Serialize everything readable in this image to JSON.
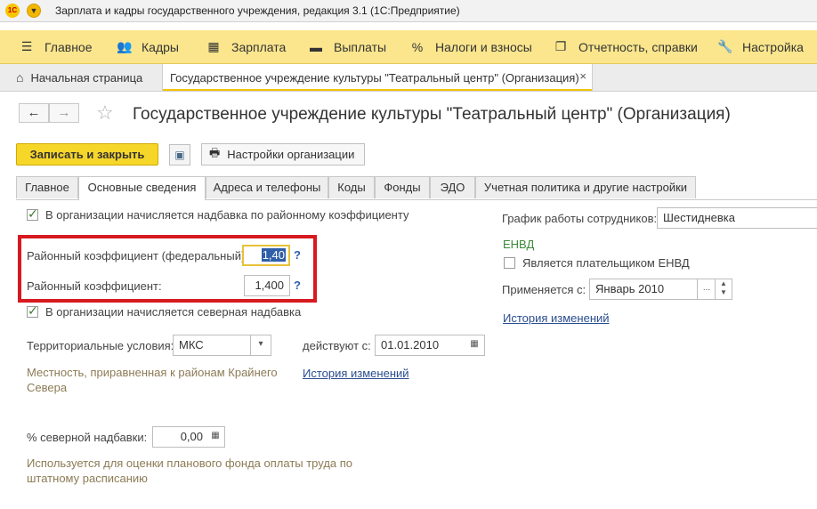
{
  "titlebar": {
    "logo_text": "1С",
    "menu_glyph": "▼",
    "title": "Зарплата и кадры государственного учреждения, редакция 3.1  (1С:Предприятие)"
  },
  "sections": [
    {
      "icon": "hamburger-icon",
      "glyph": "☰",
      "label": "Главное"
    },
    {
      "icon": "people-icon",
      "glyph": "👥",
      "label": "Кадры"
    },
    {
      "icon": "calculator-icon",
      "glyph": "▦",
      "label": "Зарплата"
    },
    {
      "icon": "wallet-icon",
      "glyph": "▬",
      "label": "Выплаты"
    },
    {
      "icon": "percent-icon",
      "glyph": "%",
      "label": "Налоги и взносы"
    },
    {
      "icon": "report-icon",
      "glyph": "❐",
      "label": "Отчетность, справки"
    },
    {
      "icon": "wrench-icon",
      "glyph": "🔧",
      "label": "Настройка"
    }
  ],
  "open_tabs": {
    "home_glyph": "⌂",
    "home_label": "Начальная страница",
    "active_label": "Государственное учреждение культуры \"Театральный центр\" (Организация)",
    "close_glyph": "×"
  },
  "nav": {
    "back_glyph": "←",
    "forward_glyph": "→",
    "star_glyph": "☆"
  },
  "form": {
    "title": "Государственное учреждение культуры \"Театральный центр\" (Организация)",
    "save_close_label": "Записать и закрыть",
    "save_glyph": "▣",
    "print_glyph": "🖶",
    "org_settings_label": "Настройки организации"
  },
  "tabs": [
    {
      "label": "Главное"
    },
    {
      "label": "Основные сведения"
    },
    {
      "label": "Адреса и телефоны"
    },
    {
      "label": "Коды"
    },
    {
      "label": "Фонды"
    },
    {
      "label": "ЭДО"
    },
    {
      "label": "Учетная политика и другие настройки"
    }
  ],
  "left": {
    "regional_checkbox_label": "В организации начисляется надбавка по районному коэффициенту",
    "regional_checked": true,
    "federal_coef_label": "Районный коэффициент (федеральный):",
    "federal_coef_value": "1,40",
    "coef_label": "Районный коэффициент:",
    "coef_value": "1,400",
    "help_glyph": "?",
    "north_checkbox_label": "В организации начисляется северная надбавка",
    "north_checked": true,
    "territorial_label": "Территориальные условия:",
    "territorial_value": "МКС",
    "effective_from_label": "действуют с:",
    "effective_from_value": "01.01.2010",
    "territorial_hint": "Местность, приравненная к районам Крайнего Севера",
    "history_link": "История изменений",
    "north_percent_label": "% северной надбавки:",
    "north_percent_value": "0,00",
    "north_percent_hint": "Используется для оценки планового фонда оплаты труда по штатному расписанию"
  },
  "right": {
    "schedule_label": "График работы сотрудников:",
    "schedule_value": "Шестидневка",
    "envd_header": "ЕНВД",
    "envd_checkbox_label": "Является плательщиком ЕНВД",
    "envd_checked": false,
    "applied_from_label": "Применяется с:",
    "applied_from_value": "Январь 2010",
    "history_link": "История изменений"
  },
  "colors": {
    "accent_yellow": "#f7d62a",
    "section_bar": "#fbe68d",
    "highlight_box": "#d71920",
    "link": "#2a4d8f",
    "hint": "#8c7b55"
  }
}
